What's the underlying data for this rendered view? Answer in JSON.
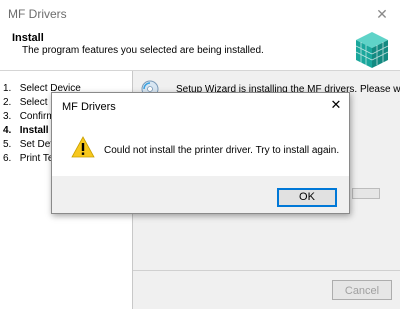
{
  "window": {
    "title": "MF Drivers",
    "close_glyph": "✕",
    "header_title": "Install",
    "header_subtitle": "The program features you selected are being installed."
  },
  "steps": [
    {
      "number": "1.",
      "label": "Select Device",
      "active": false
    },
    {
      "number": "2.",
      "label": "Select D",
      "active": false
    },
    {
      "number": "3.",
      "label": "Confirm S",
      "active": false
    },
    {
      "number": "4.",
      "label": "Install",
      "active": true
    },
    {
      "number": "5.",
      "label": "Set Defa",
      "active": false
    },
    {
      "number": "6.",
      "label": "Print Tes",
      "active": false
    }
  ],
  "status": {
    "text": "Setup Wizard is installing the MF drivers. Please wait...",
    "icon": "cd-install-icon"
  },
  "buttons": {
    "cancel_label": "Cancel"
  },
  "dialog": {
    "title": "MF Drivers",
    "close_glyph": "✕",
    "message": "Could not install the printer driver. Try to install again.",
    "icon": "warning-icon",
    "ok_label": "OK"
  },
  "colors": {
    "accent": "#0078d7",
    "warning": "#f7c81e",
    "logo": "#20b3a8"
  }
}
